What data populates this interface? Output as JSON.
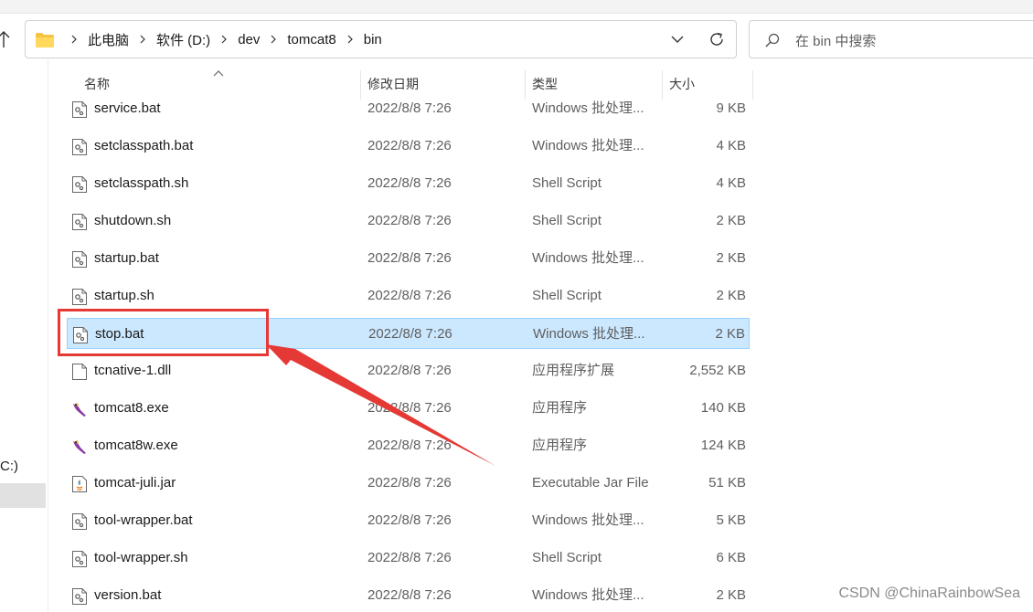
{
  "address": {
    "crumbs": [
      "此电脑",
      "软件 (D:)",
      "dev",
      "tomcat8",
      "bin"
    ]
  },
  "search": {
    "placeholder": "在 bin 中搜索"
  },
  "sidebar": {
    "drive_fragment": "C:)"
  },
  "columns": {
    "name": "名称",
    "date": "修改日期",
    "type": "类型",
    "size": "大小"
  },
  "files": [
    {
      "name": "service.bat",
      "date": "2022/8/8 7:26",
      "type": "Windows 批处理...",
      "size": "9 KB",
      "icon": "batch-file-icon"
    },
    {
      "name": "setclasspath.bat",
      "date": "2022/8/8 7:26",
      "type": "Windows 批处理...",
      "size": "4 KB",
      "icon": "batch-file-icon"
    },
    {
      "name": "setclasspath.sh",
      "date": "2022/8/8 7:26",
      "type": "Shell Script",
      "size": "4 KB",
      "icon": "script-file-icon"
    },
    {
      "name": "shutdown.sh",
      "date": "2022/8/8 7:26",
      "type": "Shell Script",
      "size": "2 KB",
      "icon": "script-file-icon"
    },
    {
      "name": "startup.bat",
      "date": "2022/8/8 7:26",
      "type": "Windows 批处理...",
      "size": "2 KB",
      "icon": "batch-file-icon"
    },
    {
      "name": "startup.sh",
      "date": "2022/8/8 7:26",
      "type": "Shell Script",
      "size": "2 KB",
      "icon": "script-file-icon"
    },
    {
      "name": "stop.bat",
      "date": "2022/8/8 7:26",
      "type": "Windows 批处理...",
      "size": "2 KB",
      "icon": "batch-file-icon",
      "selected": true
    },
    {
      "name": "tcnative-1.dll",
      "date": "2022/8/8 7:26",
      "type": "应用程序扩展",
      "size": "2,552 KB",
      "icon": "dll-file-icon"
    },
    {
      "name": "tomcat8.exe",
      "date": "2022/8/8 7:26",
      "type": "应用程序",
      "size": "140 KB",
      "icon": "tomcat-exe-icon"
    },
    {
      "name": "tomcat8w.exe",
      "date": "2022/8/8 7:26",
      "type": "应用程序",
      "size": "124 KB",
      "icon": "tomcat-exe-icon"
    },
    {
      "name": "tomcat-juli.jar",
      "date": "2022/8/8 7:26",
      "type": "Executable Jar File",
      "size": "51 KB",
      "icon": "java-jar-icon"
    },
    {
      "name": "tool-wrapper.bat",
      "date": "2022/8/8 7:26",
      "type": "Windows 批处理...",
      "size": "5 KB",
      "icon": "batch-file-icon"
    },
    {
      "name": "tool-wrapper.sh",
      "date": "2022/8/8 7:26",
      "type": "Shell Script",
      "size": "6 KB",
      "icon": "script-file-icon"
    },
    {
      "name": "version.bat",
      "date": "2022/8/8 7:26",
      "type": "Windows 批处理...",
      "size": "2 KB",
      "icon": "batch-file-icon"
    }
  ],
  "annotation": {
    "box_color": "#e53935",
    "arrow_color": "#e53935"
  },
  "watermark": "CSDN @ChinaRainbowSea"
}
